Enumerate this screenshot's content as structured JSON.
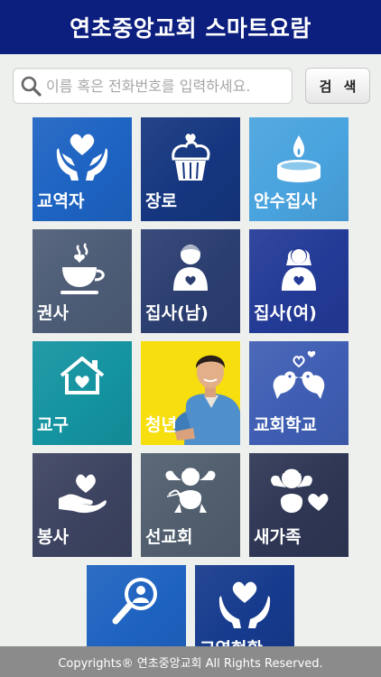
{
  "header": {
    "title": "연초중앙교회 스마트요람"
  },
  "search": {
    "placeholder": "이름 혹은 전화번호를 입력하세요.",
    "button_label": "검 색"
  },
  "tiles": [
    {
      "label": "교역자",
      "color": "#1d63c2",
      "icon": "heart-hands-icon"
    },
    {
      "label": "장로",
      "color": "#15367f",
      "icon": "cupcake-icon"
    },
    {
      "label": "안수집사",
      "color": "#49a3de",
      "icon": "candle-icon"
    },
    {
      "label": "권사",
      "color": "#4d5c76",
      "icon": "coffee-cup-icon"
    },
    {
      "label": "집사(남)",
      "color": "#2b3e70",
      "icon": "man-heart-icon"
    },
    {
      "label": "집사(여)",
      "color": "#233a96",
      "icon": "woman-heart-icon"
    },
    {
      "label": "교구",
      "color": "#1493a0",
      "icon": "house-heart-icon"
    },
    {
      "label": "청년",
      "color": "#f7de0e",
      "icon": "young-man-photo"
    },
    {
      "label": "교회학교",
      "color": "#3f5eb3",
      "icon": "love-birds-icon"
    },
    {
      "label": "봉사",
      "color": "#3c4360",
      "icon": "hand-heart-icon"
    },
    {
      "label": "선교회",
      "color": "#505e6e",
      "icon": "cupid-icon"
    },
    {
      "label": "새가족",
      "color": "#2e3654",
      "icon": "angel-heart-icon"
    },
    {
      "label": "",
      "color": "#1e62c0",
      "icon": "magnifier-person-icon"
    },
    {
      "label": "교역현황",
      "color": "#163a8c",
      "icon": "heart-hands-icon"
    }
  ],
  "footer": {
    "text": "Copyrights® 연초중앙교회 All Rights Reserved."
  }
}
